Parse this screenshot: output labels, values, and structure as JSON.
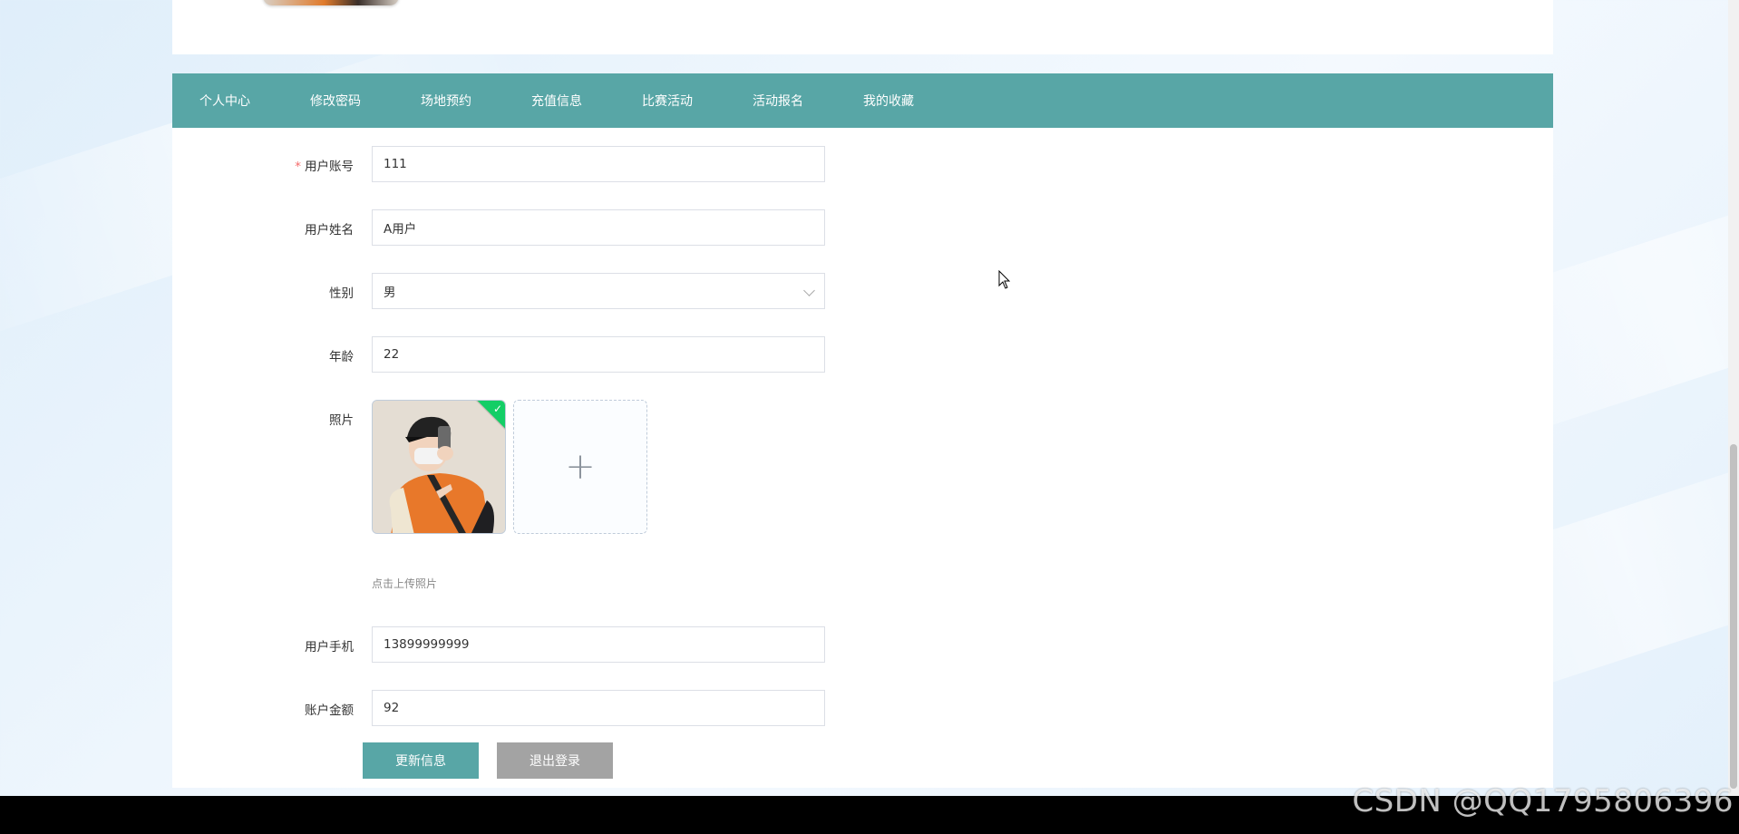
{
  "nav": {
    "items": [
      {
        "label": "个人中心",
        "active": true
      },
      {
        "label": "修改密码"
      },
      {
        "label": "场地预约"
      },
      {
        "label": "充值信息"
      },
      {
        "label": "比赛活动"
      },
      {
        "label": "活动报名"
      },
      {
        "label": "我的收藏"
      }
    ]
  },
  "form": {
    "account": {
      "label": "用户账号",
      "value": "111",
      "required": true
    },
    "name": {
      "label": "用户姓名",
      "value": "A用户"
    },
    "gender": {
      "label": "性别",
      "value": "男"
    },
    "age": {
      "label": "年龄",
      "value": "22"
    },
    "photo": {
      "label": "照片",
      "hint": "点击上传照片"
    },
    "phone": {
      "label": "用户手机",
      "value": "13899999999"
    },
    "balance": {
      "label": "账户金额",
      "value": "92"
    }
  },
  "buttons": {
    "update": "更新信息",
    "logout": "退出登录"
  },
  "watermark": "CSDN @QQ1795806396",
  "colors": {
    "nav_bg": "#58a6a6",
    "primary_button": "#58a6a6",
    "secondary_button": "#a3a3a3",
    "required_mark": "#f56c6c",
    "upload_success": "#13ce66"
  }
}
